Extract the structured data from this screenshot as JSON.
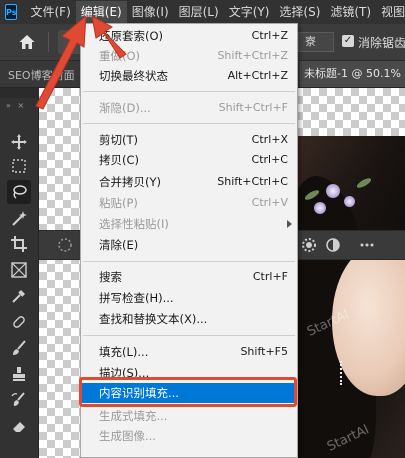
{
  "app": {
    "logo_text": "Ps"
  },
  "menubar": {
    "items": [
      {
        "label": "文件(F)"
      },
      {
        "label": "编辑(E)"
      },
      {
        "label": "图像(I)"
      },
      {
        "label": "图层(L)"
      },
      {
        "label": "文字(Y)"
      },
      {
        "label": "选择(S)"
      },
      {
        "label": "滤镜(T)"
      },
      {
        "label": "视图("
      }
    ],
    "active_index": 1
  },
  "options_bar": {
    "field_value": "寮",
    "checkbox_checked": true,
    "checkbox_label": "消除锯齿"
  },
  "tabs": {
    "left": "SEO博客封面",
    "right": "未标题-1 @ 50.1% ("
  },
  "edit_menu": {
    "items": [
      {
        "label": "还原套索(O)",
        "shortcut": "Ctrl+Z",
        "disabled": false
      },
      {
        "label": "重做(O)",
        "shortcut": "Shift+Ctrl+Z",
        "disabled": true
      },
      {
        "label": "切换最终状态",
        "shortcut": "Alt+Ctrl+Z",
        "disabled": false
      },
      {
        "label": "渐隐(D)...",
        "shortcut": "Shift+Ctrl+F",
        "disabled": true
      },
      {
        "label": "剪切(T)",
        "shortcut": "Ctrl+X",
        "disabled": false
      },
      {
        "label": "拷贝(C)",
        "shortcut": "Ctrl+C",
        "disabled": false
      },
      {
        "label": "合并拷贝(Y)",
        "shortcut": "Shift+Ctrl+C",
        "disabled": false
      },
      {
        "label": "粘贴(P)",
        "shortcut": "Ctrl+V",
        "disabled": true
      },
      {
        "label": "选择性粘贴(I)",
        "shortcut": "",
        "disabled": true,
        "submenu": true
      },
      {
        "label": "清除(E)",
        "shortcut": "",
        "disabled": false
      },
      {
        "label": "搜索",
        "shortcut": "Ctrl+F",
        "disabled": false
      },
      {
        "label": "拼写检查(H)...",
        "shortcut": "",
        "disabled": false
      },
      {
        "label": "查找和替换文本(X)...",
        "shortcut": "",
        "disabled": false
      },
      {
        "label": "填充(L)...",
        "shortcut": "Shift+F5",
        "disabled": false
      },
      {
        "label": "描边(S)...",
        "shortcut": "",
        "disabled": false
      },
      {
        "label": "内容识别填充...",
        "shortcut": "",
        "disabled": false,
        "highlighted": true
      },
      {
        "label": "生成式填充...",
        "shortcut": "",
        "disabled": true
      },
      {
        "label": "生成图像...",
        "shortcut": "",
        "disabled": true
      }
    ]
  },
  "canvas": {
    "watermark": "StartAI"
  },
  "colors": {
    "highlight": "#0078d7",
    "annotation": "#e04a35",
    "menu_bg": "#f2f2f2",
    "app_bg": "#2b2b2b"
  }
}
